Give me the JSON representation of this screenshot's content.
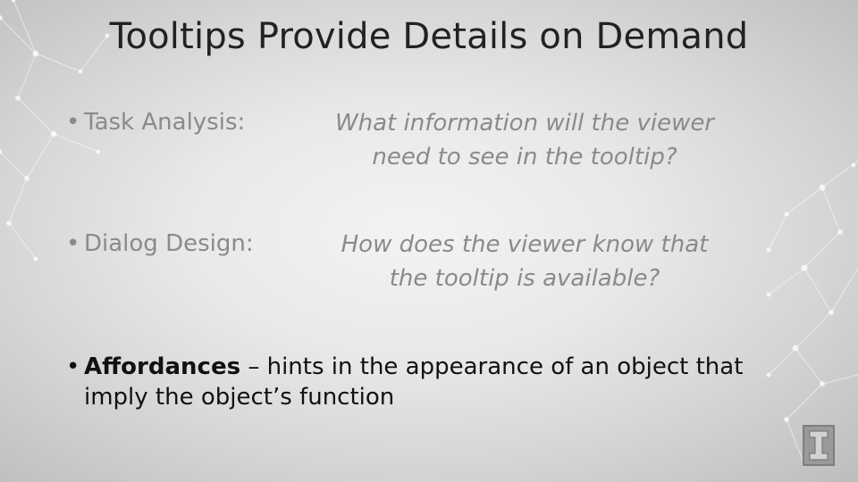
{
  "slide": {
    "title": "Tooltips Provide Details on Demand",
    "bullet_glyph": "•",
    "items": [
      {
        "label": "Task Analysis:",
        "question_line1": "What information will the viewer",
        "question_line2": "need to see in the tooltip?"
      },
      {
        "label": "Dialog Design:",
        "question_line1": "How does the viewer know that",
        "question_line2": "the tooltip is available?"
      }
    ],
    "affordances": {
      "term": "Affordances",
      "line1_rest": " – hints in the appearance of an object that",
      "line2": "imply the object’s function"
    }
  },
  "colors": {
    "title": "#222222",
    "muted_text": "#8a8a8a",
    "emphasis_text": "#111111",
    "background_center": "#f3f3f3",
    "background_edge": "#bdbdbd"
  },
  "icons": {
    "decor": "network-dots-decor",
    "logo": "university-block-i-logo"
  }
}
